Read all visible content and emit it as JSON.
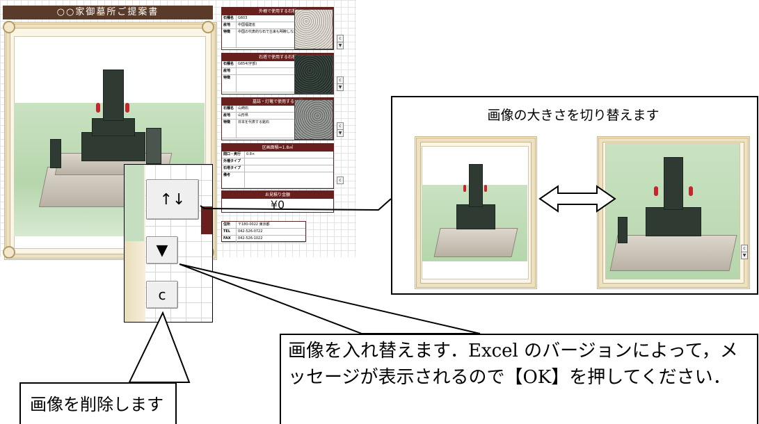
{
  "sheet": {
    "title": "○○家御墓所ご提案書",
    "stone_panels": [
      {
        "header": "外柵で使用する石種",
        "rows": [
          {
            "k": "石種名",
            "v": "G603"
          },
          {
            "k": "産地",
            "v": "中国福建省"
          },
          {
            "k": "特徴",
            "v": "中国の代表的な石で古来も明瞭しながらい人気の石種です。"
          }
        ]
      },
      {
        "header": "石塔で使用する石種",
        "rows": [
          {
            "k": "石種名",
            "v": "G654(宇部)"
          },
          {
            "k": "産地",
            "v": ""
          },
          {
            "k": "特徴",
            "v": ""
          }
        ]
      },
      {
        "header": "墓誌・灯篭で使用する石種",
        "rows": [
          {
            "k": "石種名",
            "v": "山崎石"
          },
          {
            "k": "産地",
            "v": "山形県"
          },
          {
            "k": "特徴",
            "v": "日本を代表する銘石"
          }
        ]
      }
    ],
    "type_panel": {
      "header": "区画面積=1.8㎡",
      "rows": [
        {
          "k": "間口・奥行",
          "v": "0.8×"
        },
        {
          "k": "外柵タイプ",
          "v": ""
        },
        {
          "k": "石塔タイプ",
          "v": ""
        },
        {
          "k": "備考",
          "v": ""
        }
      ]
    },
    "estimate": {
      "header": "お見積り金額",
      "amount": "¥0"
    },
    "company": {
      "rows": [
        {
          "k": "住所",
          "v": "〒180-0022 東京都"
        },
        {
          "k": "TEL",
          "v": "042-526-0722"
        },
        {
          "k": "FAX",
          "v": "042-526-1022"
        }
      ]
    },
    "mini_buttons": [
      "c",
      "▼"
    ]
  },
  "zoom": {
    "swap_size_label": "↑↓",
    "replace_label": "▼",
    "delete_label": "c"
  },
  "callouts": {
    "resize": "画像の大きさを切り替えます",
    "replace": "画像を入れ替えます．Excel のバージョンによって，メッセージが表示されるので【OK】を押してください．",
    "delete": "画像を削除します"
  },
  "colors": {
    "title_bar": "#5a3a28",
    "panel_header": "#6a1f1f",
    "photo_green": "#b6d6ac",
    "granite_dark": "#2f3a33"
  }
}
